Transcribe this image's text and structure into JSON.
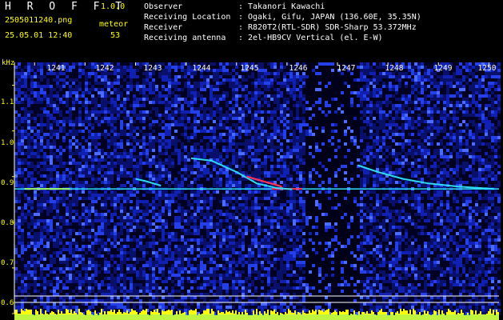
{
  "header": {
    "app_title": "H R O F F T",
    "app_version": "1.0.0",
    "filename": "2505011240.png",
    "datetime": "25.05.01 12:40",
    "detection_label": "meteor",
    "detection_count": "53",
    "info": [
      {
        "key": "Observer",
        "value": "Takanori Kawachi"
      },
      {
        "key": "Receiving Location",
        "value": "Ogaki, Gifu, JAPAN (136.60E, 35.35N)"
      },
      {
        "key": "Receiver",
        "value": "R820T2(RTL-SDR) SDR-Sharp 53.372MHz"
      },
      {
        "key": "Receiving antenna",
        "value": "2el-HB9CV Vertical (el. E-W)"
      }
    ],
    "separator": ":"
  },
  "colors": {
    "background": "#000000",
    "noise_dark": "#000033",
    "noise_mid": "#1a3cff",
    "carrier": "#2ee6ff",
    "echo_hot": "#ff3355",
    "power_bar": "#ffff00",
    "label": "#ffff00"
  },
  "chart_data": {
    "type": "heatmap",
    "title": "",
    "y_unit": "kHz",
    "x_ticks": [
      "1241",
      "1242",
      "1243",
      "1244",
      "1245",
      "1246",
      "1247",
      "1248",
      "1249",
      "1250"
    ],
    "y_ticks": [
      "1.1",
      "1.0",
      "0.9",
      "0.8",
      "0.7",
      "0.6"
    ],
    "y_tick_values": [
      1.1,
      1.0,
      0.9,
      0.8,
      0.7,
      0.6
    ],
    "ylim": [
      0.6,
      1.15
    ],
    "xlim": [
      1240.6,
      1250.2
    ],
    "carrier_khz": 0.873,
    "traces": [
      {
        "name": "echo-a",
        "points": [
          [
            1244.1,
            0.94
          ],
          [
            1244.5,
            0.935
          ],
          [
            1245.0,
            0.91
          ],
          [
            1245.4,
            0.885
          ],
          [
            1245.8,
            0.875
          ],
          [
            1246.1,
            0.872
          ]
        ]
      },
      {
        "name": "echo-b",
        "points": [
          [
            1247.4,
            0.925
          ],
          [
            1247.8,
            0.91
          ],
          [
            1248.3,
            0.895
          ],
          [
            1248.8,
            0.885
          ],
          [
            1249.4,
            0.878
          ],
          [
            1250.1,
            0.873
          ]
        ]
      },
      {
        "name": "echo-c",
        "points": [
          [
            1243.0,
            0.895
          ],
          [
            1243.2,
            0.89
          ],
          [
            1243.5,
            0.88
          ]
        ]
      }
    ]
  }
}
